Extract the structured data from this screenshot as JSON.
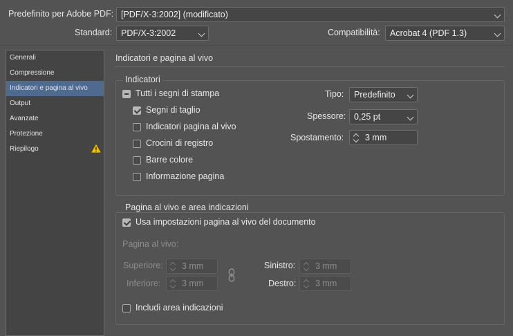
{
  "header": {
    "preset_label": "Predefinito per Adobe PDF:",
    "preset_value": "[PDF/X-3:2002] (modificato)",
    "standard_label": "Standard:",
    "standard_value": "PDF/X-3:2002",
    "compat_label": "Compatibilità:",
    "compat_value": "Acrobat 4 (PDF 1.3)"
  },
  "sidebar": {
    "items": [
      {
        "label": "Generali"
      },
      {
        "label": "Compressione"
      },
      {
        "label": "Indicatori e pagina al vivo"
      },
      {
        "label": "Output"
      },
      {
        "label": "Avanzate"
      },
      {
        "label": "Protezione"
      },
      {
        "label": "Riepilogo"
      }
    ],
    "selected": "Indicatori e pagina al vivo",
    "warning_icon": "warning-icon"
  },
  "main": {
    "section_title": "Indicatori e pagina al vivo",
    "marks": {
      "group_title": "Indicatori",
      "all_marks_label": "Tutti i segni di stampa",
      "items": [
        {
          "label": "Segni di taglio",
          "checked": true
        },
        {
          "label": "Indicatori pagina al vivo",
          "checked": false
        },
        {
          "label": "Crocini di registro",
          "checked": false
        },
        {
          "label": "Barre colore",
          "checked": false
        },
        {
          "label": "Informazione pagina",
          "checked": false
        }
      ],
      "tipo_label": "Tipo:",
      "tipo_value": "Predefinito",
      "spessore_label": "Spessore:",
      "spessore_value": "0,25 pt",
      "spostamento_label": "Spostamento:",
      "spostamento_value": "3 mm"
    },
    "bleed": {
      "group_title": "Pagina al vivo e area indicazioni",
      "use_doc_label": "Usa impostazioni pagina al vivo del documento",
      "use_doc_checked": true,
      "bleed_label": "Pagina al vivo:",
      "superiore_label": "Superiore:",
      "superiore_value": "3 mm",
      "inferiore_label": "Inferiore:",
      "inferiore_value": "3 mm",
      "sinistro_label": "Sinistro:",
      "sinistro_value": "3 mm",
      "destro_label": "Destro:",
      "destro_value": "3 mm",
      "include_slug_label": "Includi area indicazioni",
      "include_slug_checked": false
    }
  }
}
